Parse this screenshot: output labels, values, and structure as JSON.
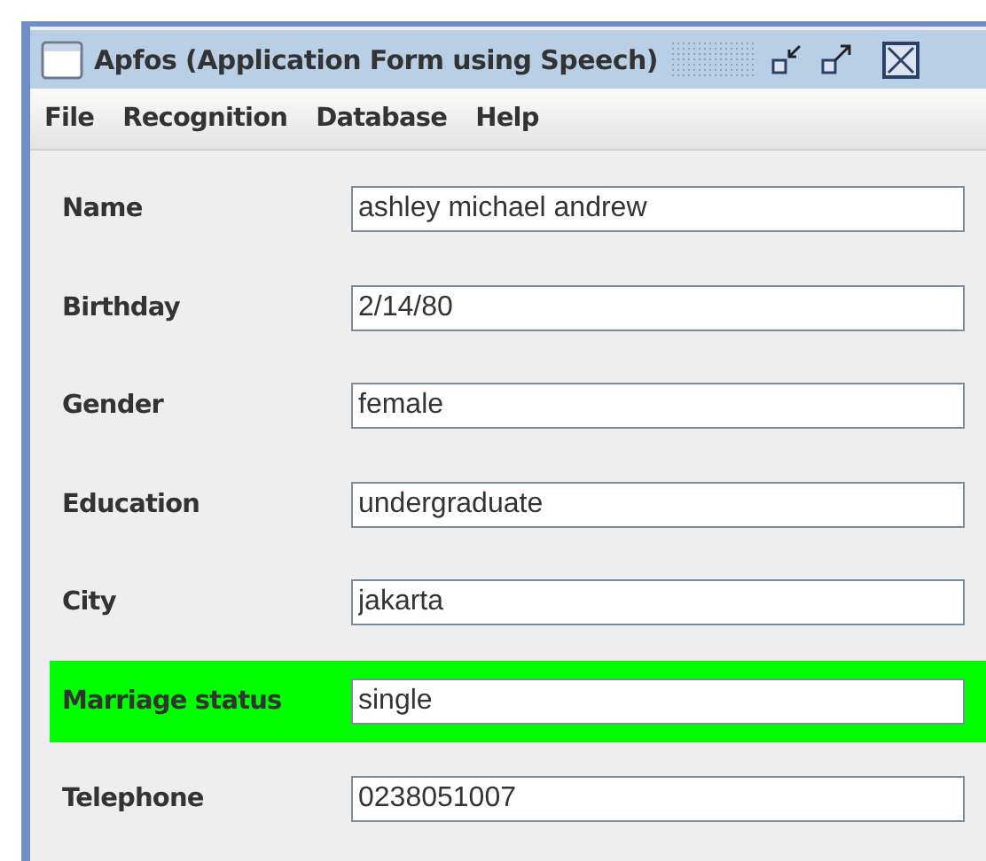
{
  "window": {
    "title": "Apfos (Application Form using Speech)"
  },
  "menu": [
    "File",
    "Recognition",
    "Database",
    "Help"
  ],
  "fields": [
    {
      "label": "Name",
      "value": "ashley michael andrew",
      "highlighted": false
    },
    {
      "label": "Birthday",
      "value": "2/14/80",
      "highlighted": false
    },
    {
      "label": "Gender",
      "value": "female",
      "highlighted": false
    },
    {
      "label": "Education",
      "value": "undergraduate",
      "highlighted": false
    },
    {
      "label": "City",
      "value": "jakarta",
      "highlighted": false
    },
    {
      "label": "Marriage status",
      "value": "single",
      "highlighted": true
    },
    {
      "label": "Telephone",
      "value": "0238051007",
      "highlighted": false
    }
  ]
}
